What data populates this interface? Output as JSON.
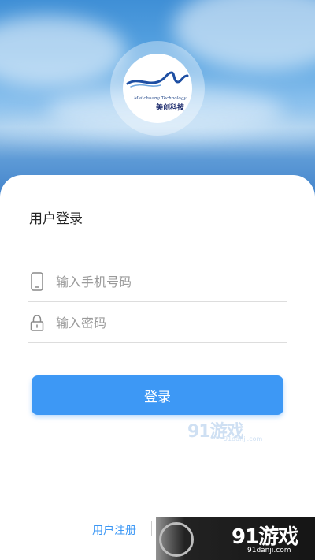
{
  "logo": {
    "english_text": "Mei chuang Technology",
    "chinese_text": "美创科技"
  },
  "login": {
    "title": "用户登录",
    "phone_placeholder": "输入手机号码",
    "password_placeholder": "输入密码",
    "login_label": "登录"
  },
  "footer": {
    "register_label": "用户注册"
  },
  "watermark": {
    "center_main": "91游戏",
    "center_sub": "91danji.com",
    "corner_main": "91游戏",
    "corner_sub": "91danji.com"
  },
  "colors": {
    "accent": "#3d98f5",
    "sky_top": "#3f8fd6",
    "title_text": "#222222",
    "placeholder": "#9a9a9a"
  },
  "icons": {
    "phone": "mobile-phone-icon",
    "password": "lock-icon"
  }
}
